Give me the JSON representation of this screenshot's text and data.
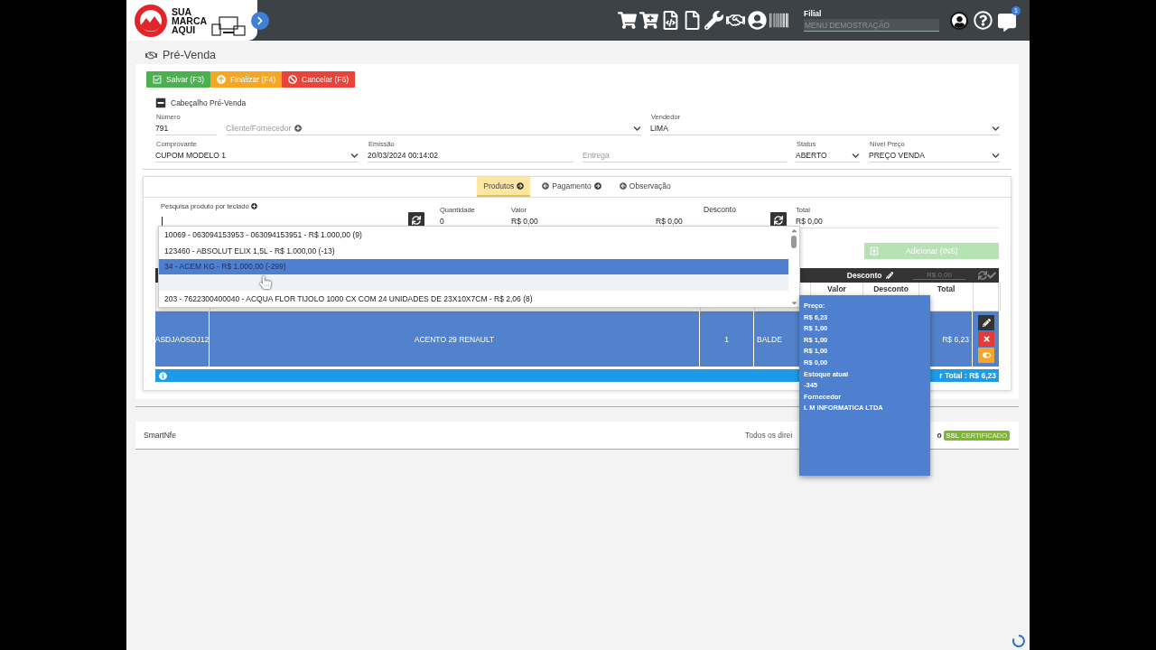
{
  "header": {
    "logo": [
      "SUA",
      "MARCA",
      "AQUI"
    ],
    "filial": {
      "label": "Filial",
      "placeholder": "MENU DEMOSTRAÇÃO"
    },
    "notifications_badge": "1"
  },
  "page_title": "Pré-Venda",
  "actions": [
    {
      "label": "Salvar (F3)",
      "kind": "save"
    },
    {
      "label": "Finalizar (F4)",
      "kind": "finish"
    },
    {
      "label": "Cancelar (F6)",
      "kind": "cancel"
    }
  ],
  "section": {
    "title": "Cabeçalho Pré-Venda",
    "expanded": true
  },
  "form_rows": [
    [
      {
        "label": "Número",
        "value": "791",
        "kind": "text"
      },
      {
        "placeholder": "Cliente/Fornecedor",
        "kind": "lookup"
      },
      {
        "label": "Vendedor",
        "value": "LIMA",
        "kind": "select"
      }
    ],
    [
      {
        "label": "Comprovante",
        "value": "CUPOM MODELO 1",
        "kind": "select"
      },
      {
        "label": "Emissão",
        "value": "20/03/2024 00:14:02",
        "kind": "text"
      },
      {
        "placeholder": "Entrega",
        "kind": "text"
      },
      {
        "label": "Status",
        "value": "ABERTO",
        "kind": "select"
      },
      {
        "label": "Nível Preço",
        "value": "PREÇO VENDA",
        "kind": "select"
      }
    ]
  ],
  "tabs": [
    {
      "label": "Produtos",
      "selected": true
    },
    {
      "label": "Pagamento",
      "selected": false
    },
    {
      "label": "Observação",
      "selected": false
    }
  ],
  "search": {
    "label": "Pesquisa produto por teclado"
  },
  "entry_fields": [
    {
      "label": "Quantidade",
      "value": "0",
      "kind": "plain"
    },
    {
      "label": "Valor",
      "value": "R$ 0,00",
      "kind": "plain"
    },
    {
      "label": "Desconto",
      "value": "R$ 0,00",
      "kind": "discount"
    },
    {
      "label": "Total",
      "value": "R$ 0,00",
      "kind": "plain"
    }
  ],
  "add_button": {
    "label": "Adicionar (INS)",
    "disabled": true
  },
  "dropdown": {
    "items": [
      {
        "text": "10069 - 063094153953 - 063094153951 - R$ 1.000,00 (9)",
        "selected": false,
        "kind": "item"
      },
      {
        "text": "123460 - ABSOLUT ELIX 1,5L - R$ 1.000,00 (-13)",
        "selected": false,
        "kind": "item"
      },
      {
        "text": "34 - ACEM KG - R$ 1.000,00 (-299)",
        "selected": true,
        "kind": "item"
      },
      {
        "kind": "blurred",
        "selected": false
      },
      {
        "text": "203 - 7622300400040 - ACQUA FLOR TIJOLO 1000 CX COM 24 UNIDADES DE 23X10X7CM - R$ 2,06 (8)",
        "selected": false,
        "kind": "item"
      }
    ]
  },
  "table": {
    "toolbar": {
      "label": "Desconto",
      "placeholder": "R$ 0,00"
    },
    "columns": [
      "Valor",
      "Desconto",
      "Total"
    ],
    "rows": [
      {
        "code": "ASDJAOSDJ12",
        "description": "ACENTO 29 RENAULT",
        "quantity": "1",
        "unit": "BALDE",
        "total": "R$ 6,23",
        "selected": true
      }
    ],
    "summary": "r Total : R$ 6,23"
  },
  "tooltip": {
    "lines": [
      "Preço:",
      "R$ 6,23",
      "R$ 1,00",
      "R$ 1,00",
      "R$ 1,00",
      "R$ 0,00",
      "Estoque atual",
      "-345",
      "Fornecedor",
      "I. M INFORMATICA LTDA"
    ]
  },
  "footer": {
    "brand": "SmartNfe",
    "rights": "Todos os direi",
    "tail": "o",
    "badge": "**SSL** CERTIFICADO"
  }
}
